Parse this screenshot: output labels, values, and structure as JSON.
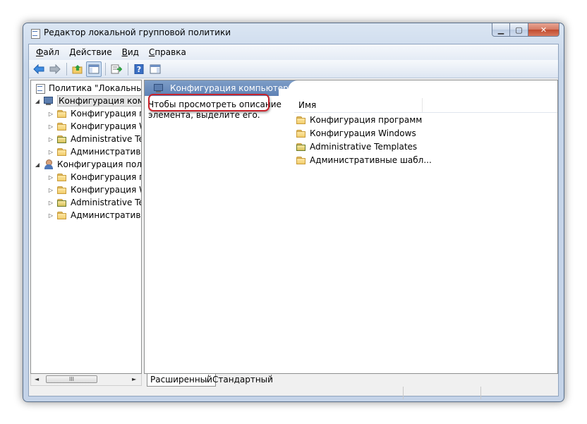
{
  "window": {
    "title": "Редактор локальной групповой политики"
  },
  "menu": {
    "items": [
      "Файл",
      "Действие",
      "Вид",
      "Справка"
    ],
    "mnemonics": [
      "Ф",
      "Д",
      "В",
      "С"
    ]
  },
  "toolbar": {
    "buttons": [
      "back-arrow-icon",
      "forward-arrow-icon",
      "up-folder-icon",
      "show-hide-tree-icon",
      "export-list-icon",
      "help-icon",
      "properties-pane-icon"
    ]
  },
  "tree": {
    "root": "Политика \"Локальный",
    "computer_config": "Конфигурация комп",
    "computer_children": [
      "Конфигурация п",
      "Конфигурация W",
      "Administrative Te",
      "Административ"
    ],
    "user_config": "Конфигурация полі",
    "user_children": [
      "Конфигурация п",
      "Конфигурация W",
      "Administrative Te",
      "Административ"
    ]
  },
  "scrollbar": {
    "left": "◄",
    "thumb": "III",
    "right": "►"
  },
  "right_pane": {
    "header": "Конфигурация компьютера",
    "description": "Чтобы просмотреть описание элемента, выделите его.",
    "column_name": "Имя",
    "items": [
      "Конфигурация программ",
      "Конфигурация Windows",
      "Administrative Templates",
      "Административные шабл..."
    ],
    "highlight_color": "#c8232c"
  },
  "tabs": {
    "extended": "Расширенный",
    "standard": "Стандартный"
  },
  "caption": {
    "minimize": "▁",
    "maximize": "▢",
    "close": "✕"
  }
}
